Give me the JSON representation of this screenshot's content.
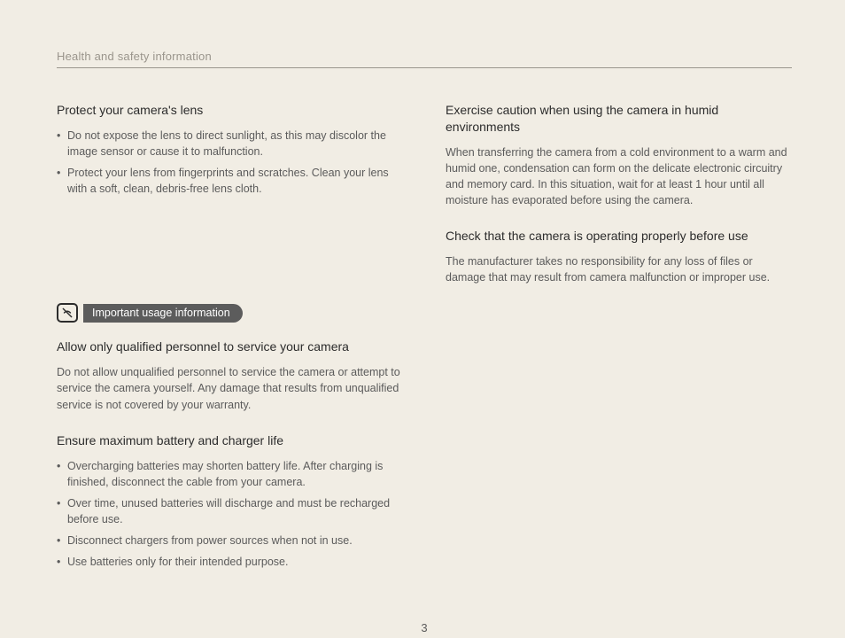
{
  "header": "Health and safety information",
  "left": {
    "s1": {
      "title": "Protect your camera's lens",
      "items": [
        "Do not expose the lens to direct sunlight, as this may discolor the image sensor or cause it to malfunction.",
        "Protect your lens from fingerprints and scratches. Clean your lens with a soft, clean, debris-free lens cloth."
      ]
    },
    "pill": "Important usage information",
    "s2": {
      "title": "Allow only qualified personnel to service your camera",
      "body": "Do not allow unqualified personnel to service the camera or attempt to service the camera yourself. Any damage that results from unqualified service is not covered by your warranty."
    },
    "s3": {
      "title": "Ensure maximum battery and charger life",
      "items": [
        "Overcharging batteries may shorten battery life. After charging is finished, disconnect the cable from your camera.",
        "Over time, unused batteries will discharge and must be recharged before use.",
        "Disconnect chargers from power sources when not in use.",
        "Use batteries only for their intended purpose."
      ]
    }
  },
  "right": {
    "s1": {
      "title": "Exercise caution when using the camera in humid environments",
      "body": "When transferring the camera from a cold environment to a warm and humid one, condensation can form on the delicate electronic circuitry and memory card. In this situation, wait for at least 1 hour until all moisture has evaporated before using the camera."
    },
    "s2": {
      "title": "Check that the camera is operating properly before use",
      "body": "The manufacturer takes no responsibility for any loss of files or damage that may result from camera malfunction or improper use."
    }
  },
  "page_number": "3"
}
